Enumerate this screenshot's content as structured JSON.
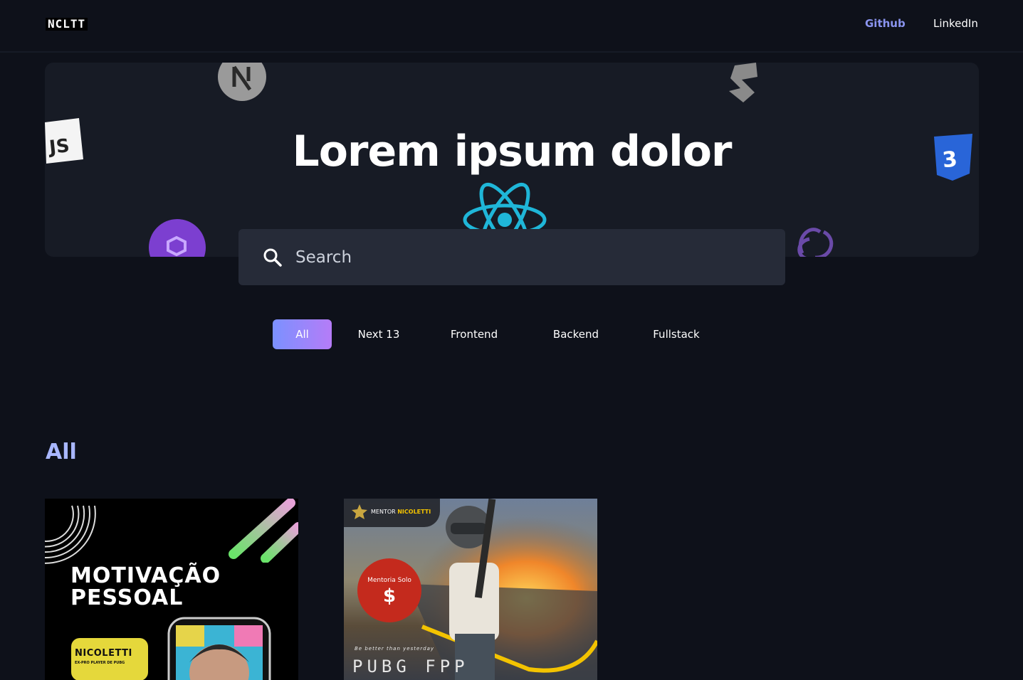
{
  "nav": {
    "logo": "NCLTT",
    "links": [
      {
        "label": "Github"
      },
      {
        "label": "LinkedIn"
      }
    ]
  },
  "hero": {
    "title": "Lorem ipsum dolor",
    "deco_icons": [
      "nextjs-icon",
      "javascript-icon",
      "react-icon",
      "polygon-icon",
      "sass-icon",
      "css3-icon",
      "redux-icon"
    ]
  },
  "search": {
    "placeholder": "Search",
    "value": ""
  },
  "filters": [
    {
      "label": "All",
      "active": true
    },
    {
      "label": "Next 13",
      "active": false
    },
    {
      "label": "Frontend",
      "active": false
    },
    {
      "label": "Backend",
      "active": false
    },
    {
      "label": "Fullstack",
      "active": false
    }
  ],
  "section": {
    "title": "All"
  },
  "cards": [
    {
      "line1": "MOTIVAÇÃO",
      "line2": "PESSOAL",
      "badge": "NICOLETTI",
      "badge_sub": "EX-PRO PLAYER DE PUBG"
    },
    {
      "tag_prefix": "MENTOR",
      "tag_name": "NICOLETTI",
      "circle_label": "Mentoria Solo",
      "circle_value": "$",
      "tagline": "Be better than yesterday",
      "game": "PUBG FPP"
    }
  ],
  "colors": {
    "background": "#0e111a",
    "hero_bg": "#171b25",
    "search_bg": "#262b38",
    "accent_from": "#7b91ff",
    "accent_to": "#b57cf7",
    "github_link": "#8a94ef",
    "section_title": "#a9b7ff"
  }
}
